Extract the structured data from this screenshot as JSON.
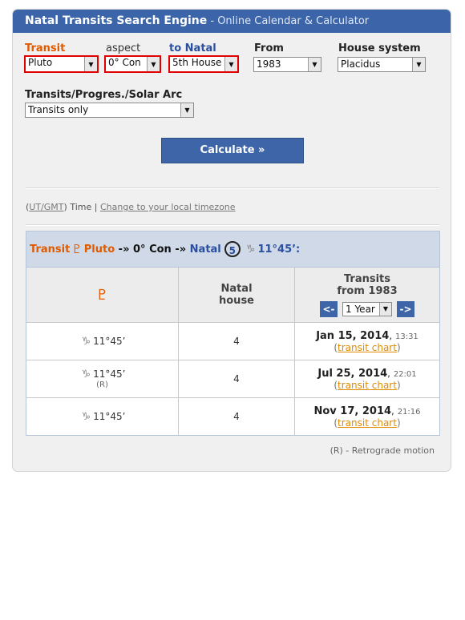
{
  "header": {
    "title": "Natal Transits Search Engine",
    "subtitle": " - Online Calendar & Calculator"
  },
  "form": {
    "transit_label": "Transit",
    "transit_value": "Pluto",
    "aspect_label": "aspect",
    "aspect_value": "0° Con",
    "natal_label": "to Natal",
    "natal_value": "5th House",
    "from_label": "From",
    "from_value": "1983",
    "house_label": "House system",
    "house_value": "Placidus",
    "mode_label": "Transits/Progres./Solar Arc",
    "mode_value": "Transits only",
    "calc_label": "Calculate »"
  },
  "timezone": {
    "utc": "UT/GMT",
    "time": "Time",
    "change": "Change to your local timezone"
  },
  "result": {
    "transit": "Transit",
    "planet_glyph": "♇",
    "planet": "Pluto",
    "arrow1": "-»",
    "aspect": "0° Con",
    "arrow2": "-»",
    "natal": "Natal",
    "house_num": "5",
    "sign_glyph": "♑",
    "position": "11°45’:"
  },
  "table": {
    "col1_glyph": "♇",
    "col2_line1": "Natal",
    "col2_line2": "house",
    "col3_line1": "Transits",
    "col3_line2": "from 1983",
    "prev": "<-",
    "next": "->",
    "period": "1 Year",
    "rows": [
      {
        "sign": "♑",
        "pos": "11°45’",
        "retro": "",
        "house": "4",
        "date": "Jan 15, 2014",
        "time": "13:31",
        "link": "transit chart"
      },
      {
        "sign": "♑",
        "pos": "11°45’",
        "retro": "(R)",
        "house": "4",
        "date": "Jul 25, 2014",
        "time": "22:01",
        "link": "transit chart"
      },
      {
        "sign": "♑",
        "pos": "11°45’",
        "retro": "",
        "house": "4",
        "date": "Nov 17, 2014",
        "time": "21:16",
        "link": "transit chart"
      }
    ]
  },
  "footer_note": "(R) - Retrograde motion",
  "icons": {
    "dropdown": "chevron-down-icon"
  },
  "colors": {
    "header_bg": "#3c65a9",
    "orange": "#e05a00",
    "blue": "#2a4fa0",
    "highlight": "#e00000"
  }
}
